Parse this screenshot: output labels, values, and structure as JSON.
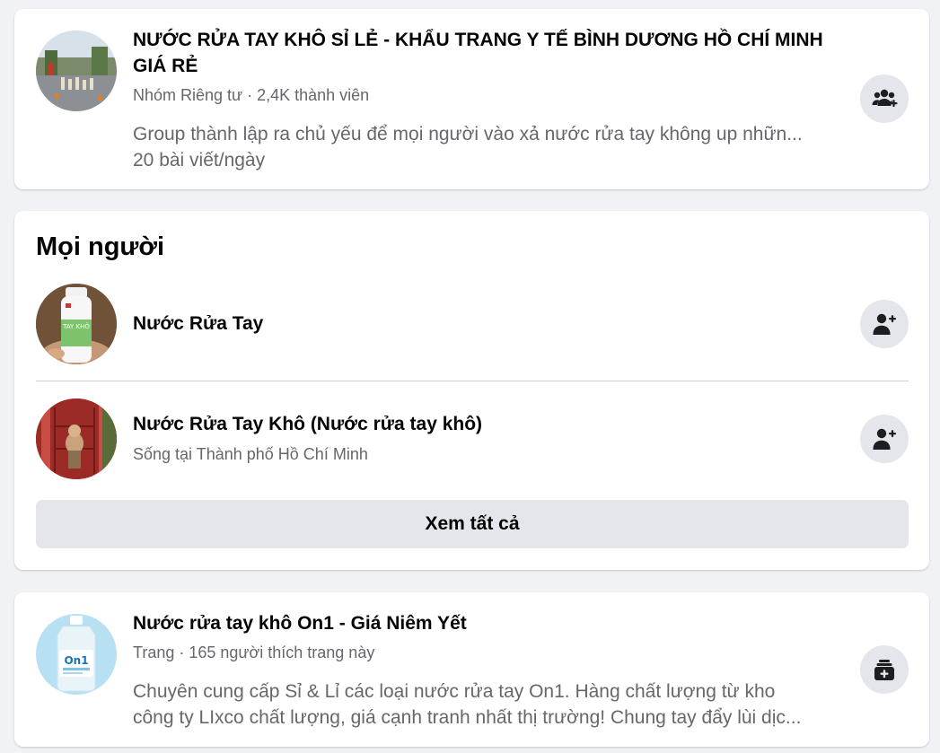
{
  "group_result": {
    "title_line1": "NƯỚC RỬA TAY KHÔ SỈ LẺ - KHẨU TRANG Y TẾ BÌNH DƯƠNG HỒ CHÍ MINH",
    "title_line2": "GIÁ RẺ",
    "meta": "Nhóm Riêng tư · 2,4K thành viên",
    "description": "Group thành lập ra chủ yếu để mọi người vào xả nước rửa tay không up nhữn...",
    "posts_per_day": "20 bài viết/ngày",
    "action_icon": "join-group-icon"
  },
  "people_section": {
    "heading": "Mọi người",
    "people": [
      {
        "name": "Nước Rửa Tay",
        "subtitle": "",
        "action_icon": "add-friend-icon"
      },
      {
        "name": "Nước Rửa Tay Khô (Nước rửa tay khô)",
        "subtitle": "Sống tại Thành phố Hồ Chí Minh",
        "action_icon": "add-friend-icon"
      }
    ],
    "see_all_label": "Xem tất cả"
  },
  "page_result": {
    "title": "Nước rửa tay khô On1 - Giá Niêm Yết",
    "meta": "Trang · 165 người thích trang này",
    "description_line1": "Chuyên cung cấp Sỉ & Lỉ các loại nước rửa tay On1. Hàng chất lượng từ kho",
    "description_line2": "công ty LIxco chất lượng, giá cạnh tranh nhất thị trường! Chung tay đẩy lùi dịc...",
    "action_icon": "like-page-icon"
  },
  "colors": {
    "background": "#f0f2f5",
    "card": "#ffffff",
    "button_gray": "#e4e6eb",
    "secondary_text": "#65676b",
    "primary_text": "#050505"
  }
}
